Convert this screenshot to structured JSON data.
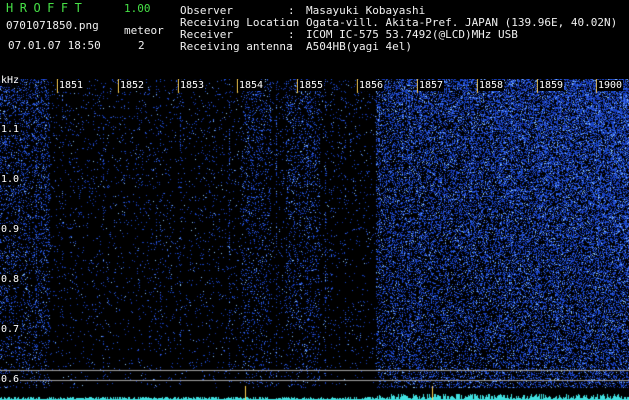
{
  "header": {
    "app_title": "HROFFT",
    "app_version": "1.00",
    "file_name": "0701071850.png",
    "detect_label": "meteor",
    "timestamp": "07.01.07 18:50",
    "meteor_count": "2"
  },
  "station_info": [
    {
      "label": "Observer",
      "value": "Masayuki Kobayashi"
    },
    {
      "label": "Receiving Location",
      "value": "Ogata-vill. Akita-Pref. JAPAN (139.96E, 40.02N)"
    },
    {
      "label": "Receiver",
      "value": "ICOM IC-575 53.7492(@LCD)MHz USB"
    },
    {
      "label": "Receiving antenna",
      "value": "A504HB(yagi 4el)"
    }
  ],
  "separator": ":",
  "spectrogram": {
    "freq_unit": "kHz",
    "time_ticks": [
      "1851",
      "1852",
      "1853",
      "1854",
      "1855",
      "1856",
      "1857",
      "1858",
      "1859",
      "1900"
    ],
    "freq_ticks": [
      "1.1",
      "1.0",
      "0.9",
      "0.8",
      "0.7",
      "0.6"
    ],
    "colors": {
      "background": "#000000",
      "noise": "#1e3cc8",
      "strong": "#8cc8ff",
      "marker_lines": "#ffd050",
      "baseline": "#40e0e0",
      "ref_lines": "#a0a0a0"
    }
  }
}
